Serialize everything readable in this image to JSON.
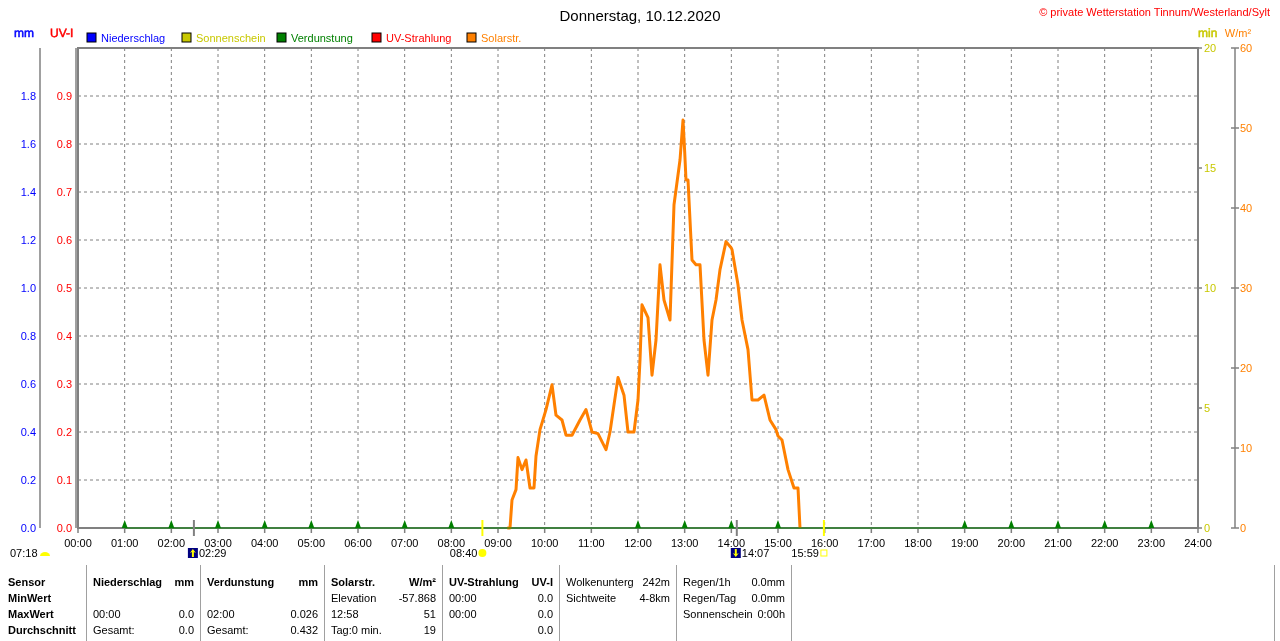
{
  "copyright": "© private Wetterstation Tinnum/Westerland/Sylt",
  "legend": [
    {
      "label": "Niederschlag",
      "color": "#0000ff"
    },
    {
      "label": "Sonnenschein",
      "color": "#c8c800"
    },
    {
      "label": "Verdunstung",
      "color": "#008000"
    },
    {
      "label": "UV-Strahlung",
      "color": "#ff0000"
    },
    {
      "label": "Solarstr.",
      "color": "#ff8000"
    }
  ],
  "axes": [
    {
      "unit": "mm",
      "color": "#0000ff",
      "ticks": [
        "1.8",
        "1.6",
        "1.4",
        "1.2",
        "1.0",
        "0.8",
        "0.6",
        "0.4",
        "0.2",
        "0.0"
      ]
    },
    {
      "unit": "UV-I",
      "color": "#ff0000",
      "ticks": [
        "0.9",
        "0.8",
        "0.7",
        "0.6",
        "0.5",
        "0.4",
        "0.3",
        "0.2",
        "0.1",
        "0.0"
      ]
    },
    {
      "unit": "min",
      "color": "#c8c800",
      "ticks": [
        "20",
        "15",
        "10",
        "5",
        "0"
      ]
    }
  ],
  "chart_data": {
    "type": "line",
    "title": "Donnerstag, 10.12.2020",
    "ylabel": "W/m²",
    "xlim": [
      0,
      24
    ],
    "ylim": [
      0,
      60
    ],
    "grid": true,
    "x": [
      1,
      2,
      3,
      4,
      5,
      6,
      7,
      8,
      9.2,
      9.257,
      9.3,
      9.386,
      9.429,
      9.514,
      9.6,
      9.686,
      9.771,
      9.814,
      9.9,
      10.029,
      10.157,
      10.243,
      10.371,
      10.457,
      10.586,
      10.757,
      10.886,
      11.014,
      11.143,
      11.314,
      11.4,
      11.571,
      11.7,
      11.786,
      11.914,
      12,
      12.043,
      12.086,
      12.214,
      12.3,
      12.386,
      12.471,
      12.557,
      12.686,
      12.771,
      12.9,
      12.964,
      13,
      13.029,
      13.071,
      13.157,
      13.243,
      13.329,
      13.414,
      13.5,
      13.586,
      13.671,
      13.757,
      13.886,
      14,
      14.014,
      14.143,
      14.229,
      14.357,
      14.443,
      14.571,
      14.7,
      14.829,
      14.957,
      15,
      15.086,
      15.214,
      15.343,
      15.429,
      15.471,
      19,
      20,
      21,
      22,
      23
    ],
    "series": [
      {
        "color": "#ff8000",
        "values": [
          null,
          null,
          null,
          null,
          null,
          null,
          null,
          null,
          0,
          0,
          3.5,
          4.8,
          8.8,
          7.3,
          8.5,
          5,
          5,
          9,
          12.3,
          14.8,
          17.9,
          14.1,
          13.5,
          11.6,
          11.6,
          13.5,
          14.8,
          12,
          11.8,
          9.8,
          12,
          18.8,
          16.6,
          12,
          12,
          16,
          21,
          27.9,
          26.3,
          19.1,
          23.5,
          32.9,
          28.5,
          26,
          40.4,
          46,
          51,
          47,
          43.5,
          43.5,
          33.5,
          32.9,
          32.9,
          23.5,
          19.1,
          26,
          28.5,
          32.3,
          35.8,
          35,
          34.8,
          30.4,
          26,
          22.3,
          16,
          16,
          16.6,
          13.5,
          12.3,
          11.5,
          11,
          7.3,
          5,
          5,
          0,
          null,
          null,
          null,
          null,
          null
        ]
      },
      {
        "color": "#008000",
        "values": [
          0,
          0,
          0,
          0,
          0,
          0,
          0,
          0,
          null,
          null,
          null,
          null,
          null,
          null,
          null,
          null,
          null,
          null,
          null,
          null,
          null,
          null,
          null,
          null,
          null,
          null,
          null,
          null,
          null,
          null,
          null,
          null,
          null,
          null,
          null,
          0,
          null,
          null,
          null,
          null,
          null,
          null,
          null,
          null,
          null,
          null,
          null,
          0,
          null,
          null,
          null,
          null,
          null,
          null,
          null,
          null,
          null,
          null,
          null,
          0,
          null,
          null,
          null,
          null,
          null,
          null,
          null,
          null,
          null,
          0,
          null,
          null,
          null,
          null,
          null,
          0,
          0,
          0,
          0,
          0
        ]
      }
    ],
    "xticks": [
      {
        "value": 0,
        "label": "00:00"
      },
      {
        "value": 1,
        "label": "01:00"
      },
      {
        "value": 2,
        "label": "02:00"
      },
      {
        "value": 3,
        "label": "03:00"
      },
      {
        "value": 4,
        "label": "04:00"
      },
      {
        "value": 5,
        "label": "05:00"
      },
      {
        "value": 6,
        "label": "06:00"
      },
      {
        "value": 7,
        "label": "07:00"
      },
      {
        "value": 8,
        "label": "08:00"
      },
      {
        "value": 9,
        "label": "09:00"
      },
      {
        "value": 10,
        "label": "10:00"
      },
      {
        "value": 11,
        "label": "11:00"
      },
      {
        "value": 12,
        "label": "12:00"
      },
      {
        "value": 13,
        "label": "13:00"
      },
      {
        "value": 14,
        "label": "14:00"
      },
      {
        "value": 15,
        "label": "15:00"
      },
      {
        "value": 16,
        "label": "16:00"
      },
      {
        "value": 17,
        "label": "17:00"
      },
      {
        "value": 18,
        "label": "18:00"
      },
      {
        "value": 19,
        "label": "19:00"
      },
      {
        "value": 20,
        "label": "20:00"
      },
      {
        "value": 21,
        "label": "21:00"
      },
      {
        "value": 22,
        "label": "22:00"
      },
      {
        "value": 23,
        "label": "23:00"
      },
      {
        "value": 24,
        "label": "24:00"
      }
    ],
    "yticks": [
      60,
      50,
      40,
      30,
      20,
      10,
      0
    ]
  },
  "astro_events": [
    {
      "kind": "daylight",
      "label": "07:18"
    },
    {
      "kind": "moonrise",
      "label": "02:29"
    },
    {
      "kind": "sunrise",
      "label": "08:40"
    },
    {
      "kind": "moonset",
      "label": "14:07"
    },
    {
      "kind": "sunset",
      "label": "15:59"
    }
  ],
  "table": {
    "row_labels": [
      "Sensor",
      "MinWert",
      "MaxWert",
      "Durchschnitt"
    ],
    "sections": [
      {
        "title": "Niederschlag",
        "unit": "mm",
        "rows": [
          {},
          {
            "label": "00:00",
            "value": "0.0"
          },
          {
            "label": "Gesamt:",
            "value": "0.0"
          }
        ]
      },
      {
        "title": "Verdunstung",
        "unit": "mm",
        "rows": [
          {},
          {
            "label": "02:00",
            "value": "0.026"
          },
          {
            "label": "Gesamt:",
            "value": "0.432"
          }
        ]
      },
      {
        "title": "Solarstr.",
        "unit": "W/m²",
        "rows": [
          {
            "label": "Elevation",
            "value": "-57.868"
          },
          {
            "label": "12:58",
            "value": "51"
          },
          {
            "label": "Tag:0 min.",
            "value": "19"
          }
        ]
      },
      {
        "title": "UV-Strahlung",
        "unit": "UV-I",
        "rows": [
          {
            "label": "00:00",
            "value": "0.0"
          },
          {
            "label": "00:00",
            "value": "0.0"
          },
          {
            "value": "0.0"
          }
        ]
      },
      {
        "rows": [
          {
            "label": "Wolkenunterg",
            "value": "242m"
          },
          {
            "label": "Sichtweite",
            "value": "4-8km"
          }
        ]
      },
      {
        "rows": [
          {
            "label": "Regen/1h",
            "value": "0.0mm"
          },
          {
            "label": "Regen/Tag",
            "value": "0.0mm"
          },
          {
            "label": "Sonnenschein",
            "value": "0:00h"
          }
        ]
      }
    ]
  }
}
